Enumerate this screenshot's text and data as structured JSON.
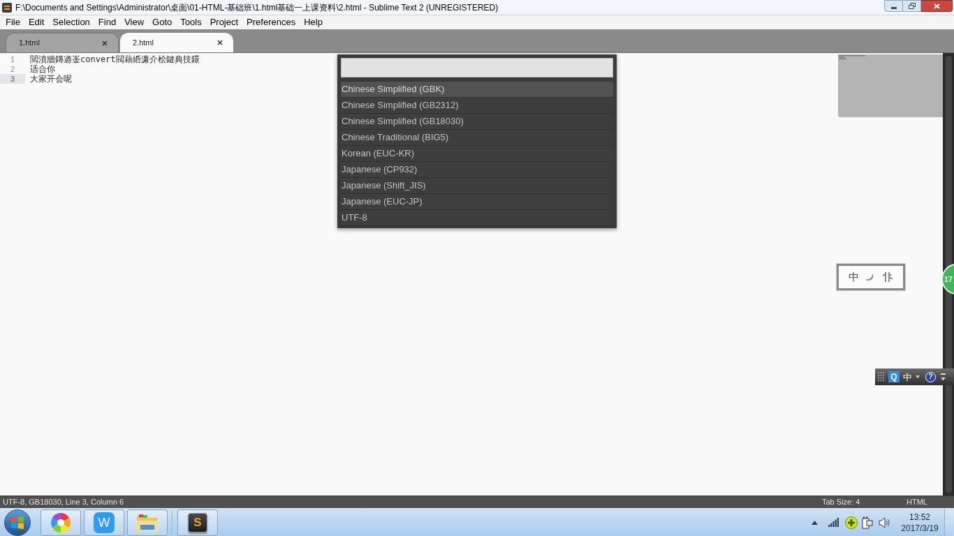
{
  "window": {
    "title": "F:\\Documents and Settings\\Administrator\\桌面\\01-HTML-基础班\\1.html基础一上课资料\\2.html - Sublime Text 2 (UNREGISTERED)"
  },
  "menu": [
    "File",
    "Edit",
    "Selection",
    "Find",
    "View",
    "Goto",
    "Tools",
    "Project",
    "Preferences",
    "Help"
  ],
  "tabs": [
    {
      "label": "1.html",
      "selected": false
    },
    {
      "label": "2.html",
      "selected": true
    }
  ],
  "editor": {
    "lines": [
      {
        "number": "1",
        "text": "閲濆牆鏄遒崟convert閥藉緍濂介桧鍵典技鐶",
        "current": false
      },
      {
        "number": "2",
        "text": "适合你",
        "current": false
      },
      {
        "number": "3",
        "text": "大家开会呢",
        "current": true
      }
    ]
  },
  "encoding_picker": {
    "items": [
      {
        "label": "Chinese Simplified (GBK)",
        "selected": true
      },
      {
        "label": "Chinese Simplified (GB2312)",
        "selected": false
      },
      {
        "label": "Chinese Simplified (GB18030)",
        "selected": false
      },
      {
        "label": "Chinese Traditional (BIG5)",
        "selected": false
      },
      {
        "label": "Korean (EUC-KR)",
        "selected": false
      },
      {
        "label": "Japanese (CP932)",
        "selected": false
      },
      {
        "label": "Japanese (Shift_JIS)",
        "selected": false
      },
      {
        "label": "Japanese (EUC-JP)",
        "selected": false
      },
      {
        "label": "UTF-8",
        "selected": false
      }
    ]
  },
  "ime_status": {
    "label": "中"
  },
  "notification_badge": {
    "count": "17"
  },
  "ime_toolbar": {
    "logo": "Q",
    "mode": "中",
    "help": "?"
  },
  "status_bar": {
    "position": "UTF-8, GB18030, Line 3, Column 6",
    "tab_size": "Tab Size: 4",
    "syntax": "HTML"
  },
  "taskbar": {
    "apps": [
      {
        "kind": "pinwheel"
      },
      {
        "kind": "wps",
        "glyph": "W"
      },
      {
        "kind": "explorer"
      },
      {
        "kind": "sublime",
        "glyph": "S"
      }
    ],
    "clock": {
      "time": "13:52",
      "date": "2017/3/19"
    }
  }
}
